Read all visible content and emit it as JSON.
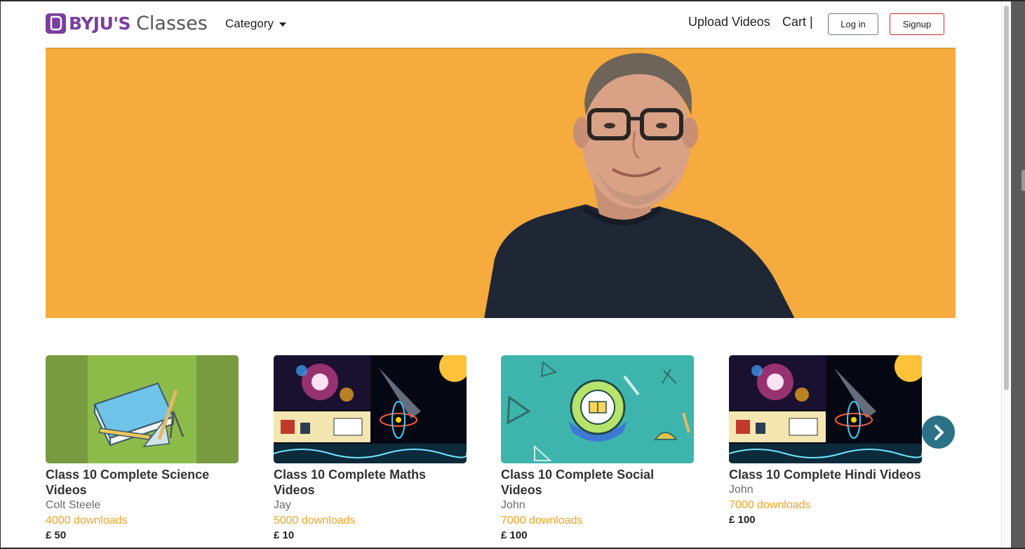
{
  "header": {
    "brand": "BYJU'S",
    "brand_suffix": "Classes",
    "category_label": "Category",
    "upload_label": "Upload Videos",
    "cart_label": "Cart |",
    "login_label": "Log in",
    "signup_label": "Signup"
  },
  "colors": {
    "brand_purple": "#7b3fa0",
    "hero_orange": "#f5ab3d",
    "downloads_orange": "#f1a326",
    "signup_red": "#c8282f",
    "next_button_teal": "#2b7286"
  },
  "courses": [
    {
      "title": "Class 10 Complete Science Videos",
      "author": "Colt Steele",
      "downloads": "4000 downloads",
      "price": "£ 50"
    },
    {
      "title": "Class 10 Complete Maths Videos",
      "author": "Jay",
      "downloads": "5000 downloads",
      "price": "£ 10"
    },
    {
      "title": "Class 10 Complete Social Videos",
      "author": "John",
      "downloads": "7000 downloads",
      "price": "£ 100"
    },
    {
      "title": "Class 10 Complete Hindi Videos",
      "author": "John",
      "downloads": "7000 downloads",
      "price": "£ 100"
    }
  ],
  "icons": {
    "logo": "byjus-logo-icon",
    "category_caret": "caret-down-icon",
    "next": "chevron-right-icon"
  }
}
